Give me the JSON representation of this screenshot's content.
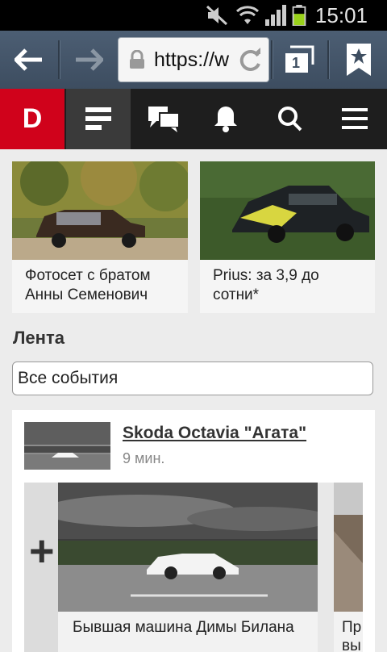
{
  "status": {
    "time": "15:01"
  },
  "browser": {
    "url": "https://w",
    "tabs_count": "1"
  },
  "site": {
    "logo": "D",
    "nav": [
      "feed-icon",
      "messages-icon",
      "bell-icon",
      "search-icon",
      "menu-icon"
    ]
  },
  "featured": [
    {
      "caption": "Фотосет с братом Анны Семенович"
    },
    {
      "caption": "Prius: за 3,9 до сотни*"
    }
  ],
  "feed": {
    "section_title": "Лента",
    "filter": "Все события",
    "post": {
      "title": "Skoda Octavia \"Агата\"",
      "ago": "9 мин.",
      "plus": "+",
      "slide_caption": "Бывшая машина Димы Билана",
      "next_caption": "Пр вы"
    }
  },
  "colors": {
    "brand": "#d0021b",
    "nav_bg": "#1e1e1e",
    "chrome": "#4c5e73"
  }
}
